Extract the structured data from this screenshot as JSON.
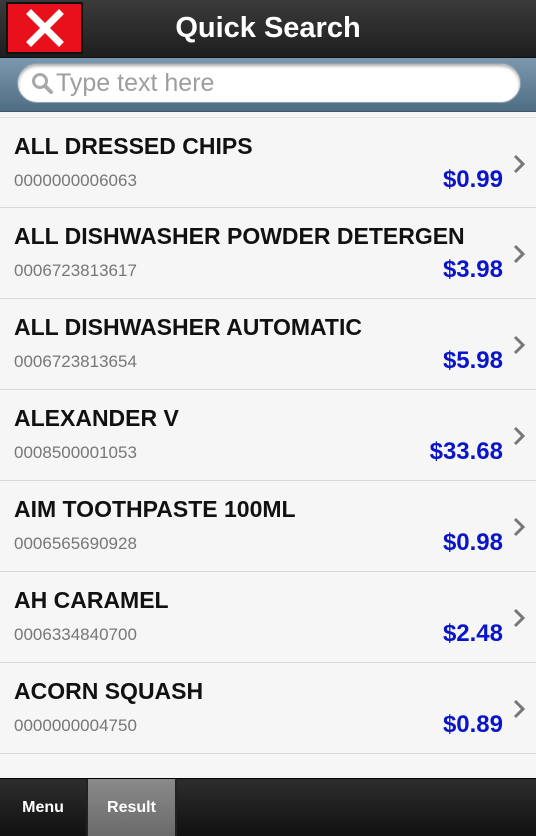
{
  "header": {
    "title": "Quick Search",
    "close_icon": "close-x-icon"
  },
  "search": {
    "placeholder": "Type text here",
    "value": "",
    "icon": "search-icon"
  },
  "results": [
    {
      "name": "ALL DRESSED CHIPS",
      "code": "0000000006063",
      "price": "$0.99"
    },
    {
      "name": "ALL DISHWASHER POWDER DETERGEN",
      "code": "0006723813617",
      "price": "$3.98"
    },
    {
      "name": "ALL DISHWASHER AUTOMATIC",
      "code": "0006723813654",
      "price": "$5.98"
    },
    {
      "name": "ALEXANDER V",
      "code": "0008500001053",
      "price": "$33.68"
    },
    {
      "name": "AIM TOOTHPASTE 100ML",
      "code": "0006565690928",
      "price": "$0.98"
    },
    {
      "name": "AH CARAMEL",
      "code": "0006334840700",
      "price": "$2.48"
    },
    {
      "name": "ACORN SQUASH",
      "code": "0000000004750",
      "price": "$0.89"
    }
  ],
  "footer": {
    "tabs": [
      {
        "label": "Menu",
        "active": false
      },
      {
        "label": "Result",
        "active": true
      }
    ]
  },
  "colors": {
    "price": "#0a14c8",
    "close_button": "#e8101b",
    "header_bg": "#2b2b2b",
    "search_bar_bg": "#6a879d",
    "active_tab_bg": "#7a7a7a"
  }
}
